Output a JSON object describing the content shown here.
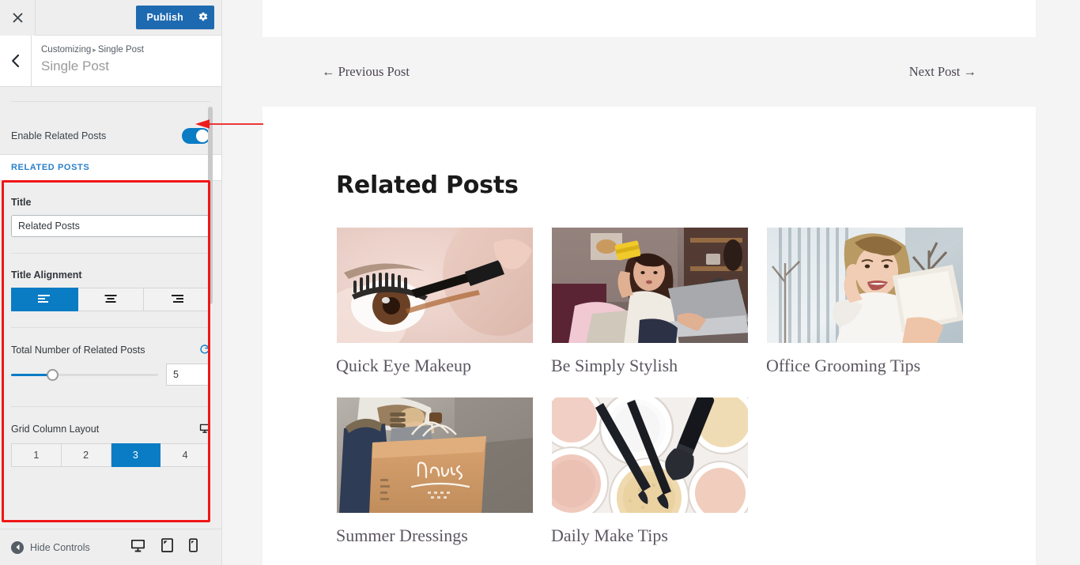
{
  "customizer": {
    "topbar": {
      "close_icon": "close-icon",
      "publish_label": "Publish",
      "gear_icon": "gear-icon"
    },
    "header": {
      "back_icon": "chevron-left-icon",
      "breadcrumb_root": "Customizing",
      "breadcrumb_sep": "▸",
      "breadcrumb_current": "Single Post",
      "panel_title": "Single Post"
    },
    "enable_related": {
      "label": "Enable Related Posts",
      "toggle_on": true,
      "accent": "#0a7cc4"
    },
    "section_title": "RELATED POSTS",
    "controls": {
      "title": {
        "label": "Title",
        "value": "Related Posts",
        "placeholder": ""
      },
      "title_alignment": {
        "label": "Title Alignment",
        "options": [
          "align-left-icon",
          "align-center-icon",
          "align-right-icon"
        ],
        "selected_index": 0
      },
      "total_posts": {
        "label": "Total Number of Related Posts",
        "reset_icon": "reset-icon",
        "value": "5",
        "slider_percent": 28
      },
      "grid_columns": {
        "label": "Grid Column Layout",
        "device_icon": "desktop-icon",
        "options": [
          "1",
          "2",
          "3",
          "4"
        ],
        "selected": "3"
      }
    },
    "footer": {
      "hide_controls_label": "Hide Controls",
      "collapse_icon": "collapse-left-icon",
      "devices": [
        "desktop-icon",
        "tablet-icon",
        "mobile-icon"
      ],
      "active_device": "desktop-icon"
    },
    "annotation": {
      "box_color": "#f01616",
      "arrow_color": "#ee1c1c"
    }
  },
  "preview": {
    "nav": {
      "previous_label": "← Previous Post",
      "next_label": "Next Post →"
    },
    "heading": "Related Posts",
    "posts": [
      {
        "title": "Quick Eye Makeup",
        "image": "eye-mascara-closeup-photo"
      },
      {
        "title": "Be Simply Stylish",
        "image": "woman-laptop-credit-card-photo"
      },
      {
        "title": "Office Grooming Tips",
        "image": "smiling-woman-tablet-outdoors-photo"
      },
      {
        "title": "Summer Dressings",
        "image": "shopping-bags-henry-photo"
      },
      {
        "title": "Daily Make Tips",
        "image": "makeup-powders-brushes-photo"
      }
    ]
  }
}
